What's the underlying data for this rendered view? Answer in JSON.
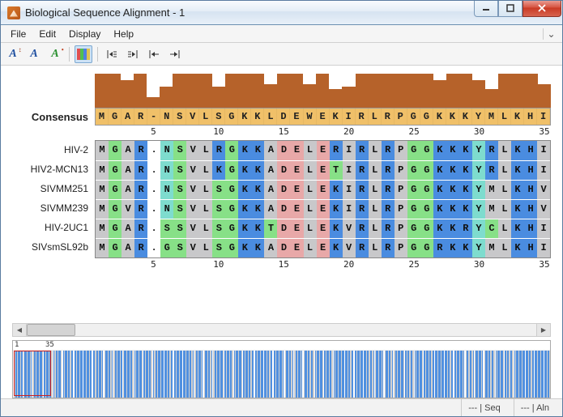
{
  "window": {
    "title": "Biological Sequence Alignment - 1"
  },
  "menu": {
    "items": [
      "File",
      "Edit",
      "Display",
      "Help"
    ]
  },
  "toolbar": {
    "font_plus": "A",
    "font_a": "A",
    "font_color": "A",
    "color_mode": "color-bars",
    "indent_left": "⇤",
    "indent_right": "⇥",
    "outdent_left": "⇤",
    "outdent_right": "⇥"
  },
  "consensus": {
    "label": "Consensus"
  },
  "ruler": {
    "ticks": [
      5,
      10,
      15,
      20,
      25,
      30,
      35
    ]
  },
  "sequences": {
    "names": [
      "HIV-2",
      "HIV2-MCN13",
      "SIVMM251",
      "SIVMM239",
      "HIV-2UC1",
      "SIVsmSL92b"
    ],
    "consensus": "MGAR-NSVLSGKKLDEWEKIRLRPGGKKKYMLKHI",
    "rows": [
      "MGAR.NSVLRGKKADELERIRLRPGGKKKYRLKHI",
      "MGAR.NSVLKGKKADELETIRLRPGGKKKYRLKHI",
      "MGAR.NSVLSGKKADELEKIRLRPGGKKKYMLKHV",
      "MGVR.NSVLSGKKADELEKIRLRPGGKKKYMLKHV",
      "MGAR.SSVLSGKKTDELEKVRLRPGGKKRYCLKHI",
      "MGAR.GSVLSGKKADELEKVRLRPGGRKKYMLKHI"
    ],
    "histogram": [
      1.0,
      1.0,
      0.82,
      1.0,
      0.32,
      0.62,
      1.0,
      1.0,
      1.0,
      0.62,
      1.0,
      1.0,
      1.0,
      0.7,
      1.0,
      1.0,
      0.7,
      1.0,
      0.55,
      0.62,
      1.0,
      1.0,
      1.0,
      1.0,
      1.0,
      1.0,
      0.82,
      1.0,
      1.0,
      0.82,
      0.55,
      1.0,
      1.0,
      1.0,
      0.7
    ]
  },
  "overview": {
    "start": 1,
    "end": 35,
    "row_start": 1,
    "row_end": 6
  },
  "status": {
    "seq": "--- | Seq",
    "aln": "--- | Aln"
  },
  "colors": {
    "M": "c-grey",
    "G": "c-green",
    "A": "c-grey",
    "R": "c-blue",
    "V": "c-grey",
    "N": "c-teal",
    "S": "c-green",
    "L": "c-grey",
    "K": "c-blue",
    "D": "c-red",
    "E": "c-red",
    "W": "c-grey",
    "I": "c-grey",
    "T": "c-green",
    "P": "c-grey",
    "Y": "c-teal",
    "H": "c-blue",
    "C": "c-green",
    ".": "c-gap",
    "-": "c-gap"
  }
}
